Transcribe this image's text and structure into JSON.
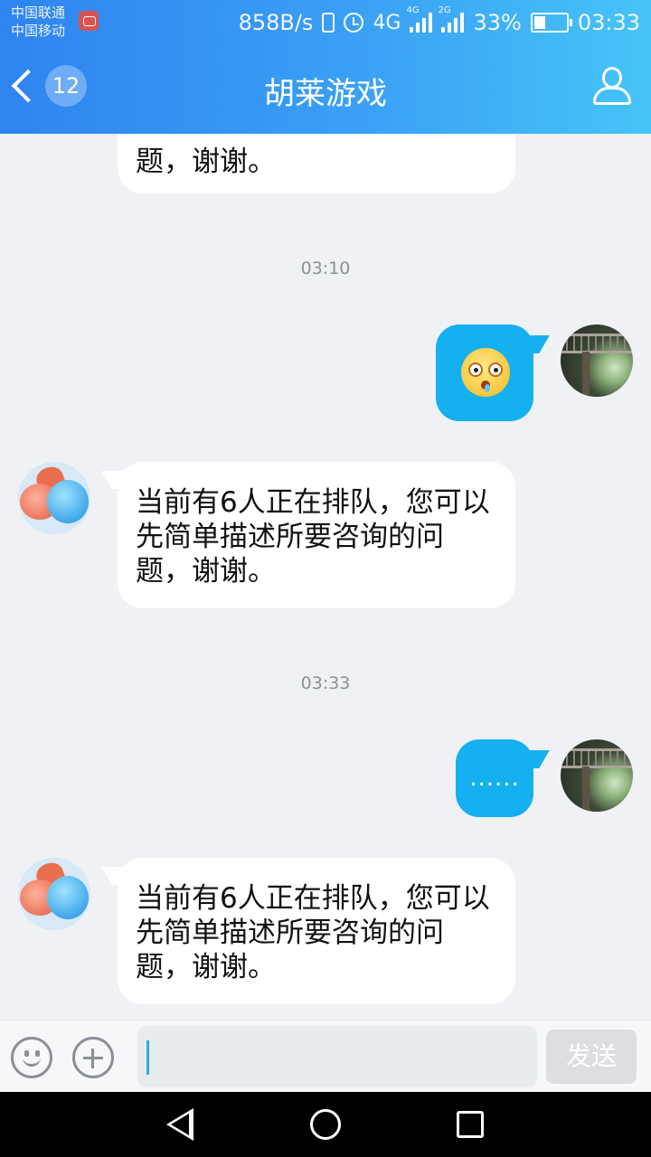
{
  "status_bar": {
    "carrier_1": "中国联通",
    "carrier_2": "中国移动",
    "net_speed": "858B/s",
    "net_4g": "4G",
    "net_4g_small": "4G",
    "net_2g": "2G",
    "battery": "33%",
    "time": "03:33"
  },
  "header": {
    "back_count": "12",
    "title": "胡莱游戏",
    "accent_color": "#2f84f0"
  },
  "messages": [
    {
      "type": "incoming_partial",
      "text": "题，谢谢。"
    },
    {
      "type": "timestamp",
      "text": "03:10"
    },
    {
      "type": "outgoing_emoji",
      "icon": "shocked-face-emoji"
    },
    {
      "type": "incoming",
      "text": "当前有6人正在排队，您可以先简单描述所要咨询的问题，谢谢。"
    },
    {
      "type": "timestamp",
      "text": "03:33"
    },
    {
      "type": "outgoing",
      "text": "......"
    },
    {
      "type": "incoming",
      "text": "当前有6人正在排队，您可以先简单描述所要咨询的问题，谢谢。"
    }
  ],
  "input_bar": {
    "placeholder": "",
    "send_label": "发送"
  }
}
